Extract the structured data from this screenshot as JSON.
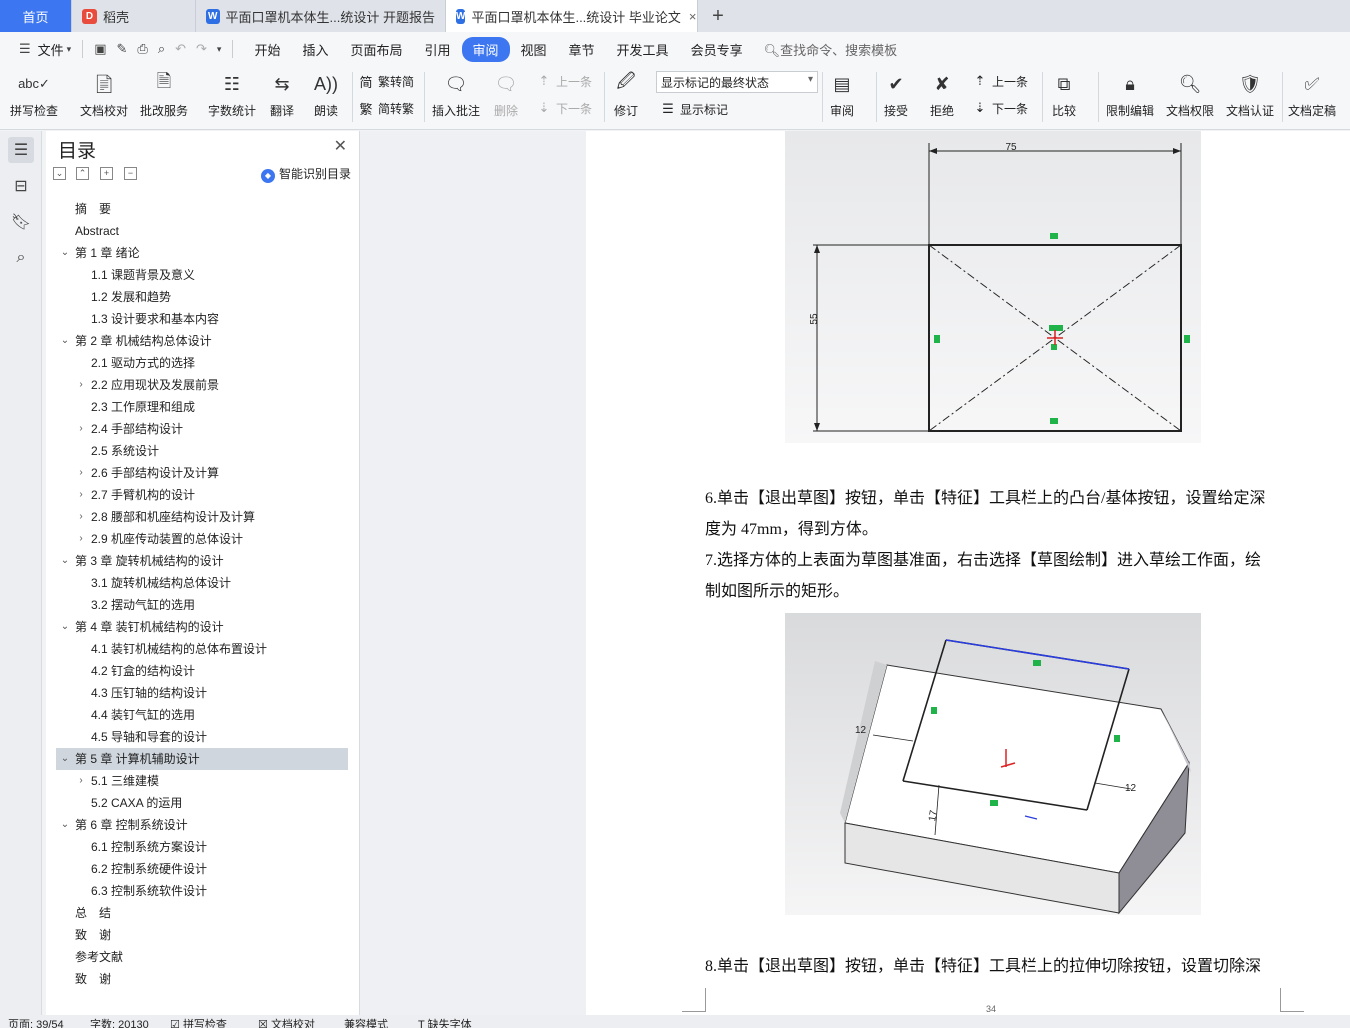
{
  "tabs": {
    "home": "首页",
    "daoke": "稻壳",
    "doc1": "平面口罩机本体生...统设计 开题报告",
    "doc2": "平面口罩机本体生...统设计 毕业论文",
    "close_icon": "×",
    "add_icon": "+"
  },
  "menu": {
    "file": "文件",
    "items": [
      "开始",
      "插入",
      "页面布局",
      "引用",
      "审阅",
      "视图",
      "章节",
      "开发工具",
      "会员专享"
    ],
    "active": "审阅",
    "search_placeholder": "查找命令、搜索模板"
  },
  "ribbon": {
    "spell_check": "拼写检查",
    "doc_proof": "文档校对",
    "batch_service": "批改服务",
    "word_count": "字数统计",
    "translate": "翻译",
    "read_aloud": "朗读",
    "trad_to_simp": "繁转简",
    "simp_to_trad": "简转繁",
    "insert_comment": "插入批注",
    "delete": "删除",
    "prev_item": "上一条",
    "next_item": "下一条",
    "track_changes": "修订",
    "markup_mode": "显示标记的最终状态",
    "show_markup": "显示标记",
    "review": "审阅",
    "accept": "接受",
    "reject": "拒绝",
    "prev_change": "上一条",
    "next_change": "下一条",
    "compare": "比较",
    "restrict_edit": "限制编辑",
    "doc_permission": "文档权限",
    "doc_cert": "文档认证",
    "doc_finalize": "文档定稿"
  },
  "nav": {
    "title": "目录",
    "smart_toc": "智能识别目录",
    "toc": [
      {
        "label": "摘　要",
        "level": 1,
        "chev": ""
      },
      {
        "label": "Abstract",
        "level": 1,
        "chev": ""
      },
      {
        "label": "第 1 章  绪论",
        "level": 1,
        "chev": "open"
      },
      {
        "label": "1.1  课题背景及意义",
        "level": 2,
        "chev": ""
      },
      {
        "label": "1.2  发展和趋势",
        "level": 2,
        "chev": ""
      },
      {
        "label": "1.3  设计要求和基本内容",
        "level": 2,
        "chev": ""
      },
      {
        "label": "第 2 章  机械结构总体设计",
        "level": 1,
        "chev": "open"
      },
      {
        "label": "2.1  驱动方式的选择",
        "level": 2,
        "chev": ""
      },
      {
        "label": "2.2  应用现状及发展前景",
        "level": 2,
        "chev": "closed"
      },
      {
        "label": "2.3  工作原理和组成",
        "level": 2,
        "chev": ""
      },
      {
        "label": "2.4 手部结构设计",
        "level": 2,
        "chev": "closed"
      },
      {
        "label": "2.5 系统设计",
        "level": 2,
        "chev": ""
      },
      {
        "label": "2.6 手部结构设计及计算",
        "level": 2,
        "chev": "closed"
      },
      {
        "label": "2.7 手臂机构的设计",
        "level": 2,
        "chev": "closed"
      },
      {
        "label": "2.8 腰部和机座结构设计及计算",
        "level": 2,
        "chev": "closed"
      },
      {
        "label": "2.9 机座传动装置的总体设计",
        "level": 2,
        "chev": "closed"
      },
      {
        "label": "第 3 章  旋转机械结构的设计",
        "level": 1,
        "chev": "open"
      },
      {
        "label": "3.1 旋转机械结构总体设计",
        "level": 2,
        "chev": ""
      },
      {
        "label": "3.2 摆动气缸的选用",
        "level": 2,
        "chev": ""
      },
      {
        "label": "第 4 章  装钉机械结构的设计",
        "level": 1,
        "chev": "open"
      },
      {
        "label": "4.1  装钉机械结构的总体布置设计",
        "level": 2,
        "chev": ""
      },
      {
        "label": "4.2 钉盒的结构设计",
        "level": 2,
        "chev": ""
      },
      {
        "label": "4.3 压钉轴的结构设计",
        "level": 2,
        "chev": ""
      },
      {
        "label": "4.4 装钉气缸的选用",
        "level": 2,
        "chev": ""
      },
      {
        "label": "4.5 导轴和导套的设计",
        "level": 2,
        "chev": ""
      },
      {
        "label": "第 5 章  计算机辅助设计",
        "level": 1,
        "chev": "open",
        "selected": true
      },
      {
        "label": "5.1  三维建模",
        "level": 2,
        "chev": "closed"
      },
      {
        "label": "5.2 CAXA 的运用",
        "level": 2,
        "chev": ""
      },
      {
        "label": "第 6 章  控制系统设计",
        "level": 1,
        "chev": "open"
      },
      {
        "label": "6.1 控制系统方案设计",
        "level": 2,
        "chev": ""
      },
      {
        "label": "6.2 控制系统硬件设计",
        "level": 2,
        "chev": ""
      },
      {
        "label": "6.3 控制系统软件设计",
        "level": 2,
        "chev": ""
      },
      {
        "label": "总　结",
        "level": 1,
        "chev": ""
      },
      {
        "label": "致　谢",
        "level": 1,
        "chev": ""
      },
      {
        "label": "参考文献",
        "level": 1,
        "chev": ""
      },
      {
        "label": "致　谢",
        "level": 1,
        "chev": ""
      }
    ]
  },
  "doc": {
    "fig1": {
      "dim_top": "75",
      "dim_left": "55"
    },
    "para6_line1": "6.单击【退出草图】按钮，单击【特征】工具栏上的凸台/基体按钮，设置给定深",
    "para6_line2": "度为 47mm，得到方体。",
    "para7_line1": "7.选择方体的上表面为草图基准面，右击选择【草图绘制】进入草绘工作面，绘",
    "para7_line2": "制如图所示的矩形。",
    "fig2": {
      "dim_left": "12",
      "dim_right": "12",
      "dim_bottom": "17"
    },
    "para8_line1": "8.单击【退出草图】按钮，单击【特征】工具栏上的拉伸切除按钮，设置切除深",
    "page_number": "34"
  },
  "status": {
    "page": "页面: 39/54",
    "words": "字数: 20130",
    "spell": "拼写检查",
    "proof": "文档校对",
    "compat": "兼容模式",
    "missing_font": "缺失字体"
  },
  "colors": {
    "accent": "#3c76f0",
    "selected_row": "#cfd6de"
  }
}
